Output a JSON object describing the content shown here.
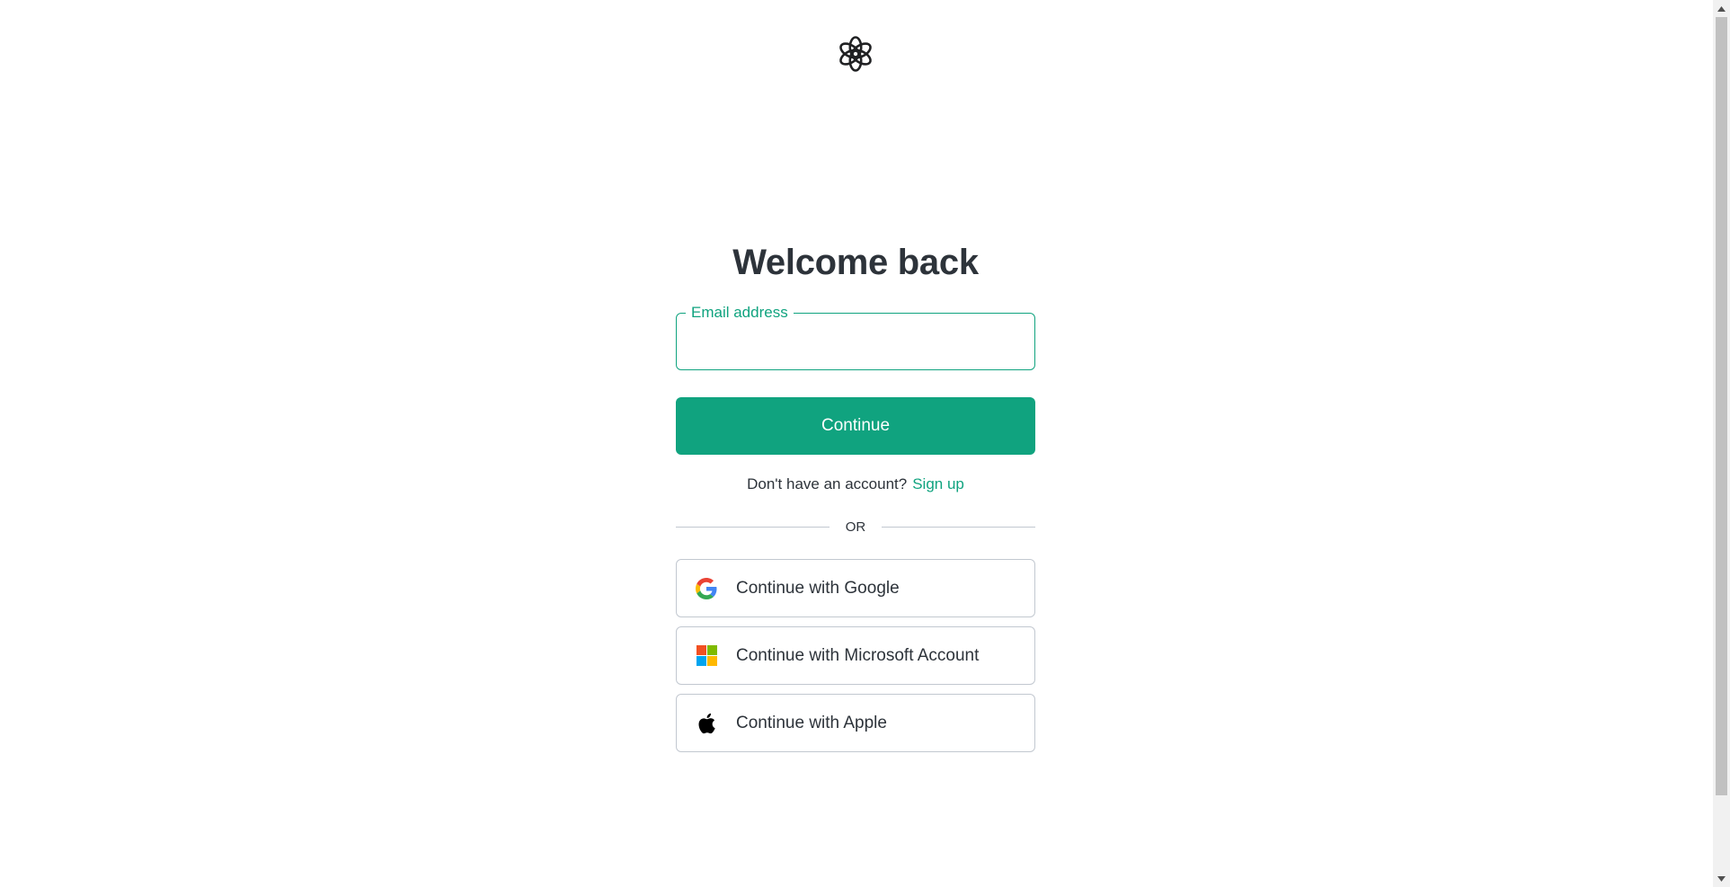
{
  "page": {
    "title": "Welcome back"
  },
  "form": {
    "email_label": "Email address",
    "email_value": "",
    "continue_label": "Continue"
  },
  "signup": {
    "prompt": "Don't have an account?",
    "link_label": "Sign up"
  },
  "divider": {
    "label": "OR"
  },
  "social_buttons": [
    {
      "label": "Continue with Google",
      "icon": "google-icon"
    },
    {
      "label": "Continue with Microsoft Account",
      "icon": "microsoft-icon"
    },
    {
      "label": "Continue with Apple",
      "icon": "apple-icon"
    }
  ],
  "colors": {
    "accent": "#10a37f",
    "text": "#2d333a",
    "border": "#c2c8d0"
  }
}
